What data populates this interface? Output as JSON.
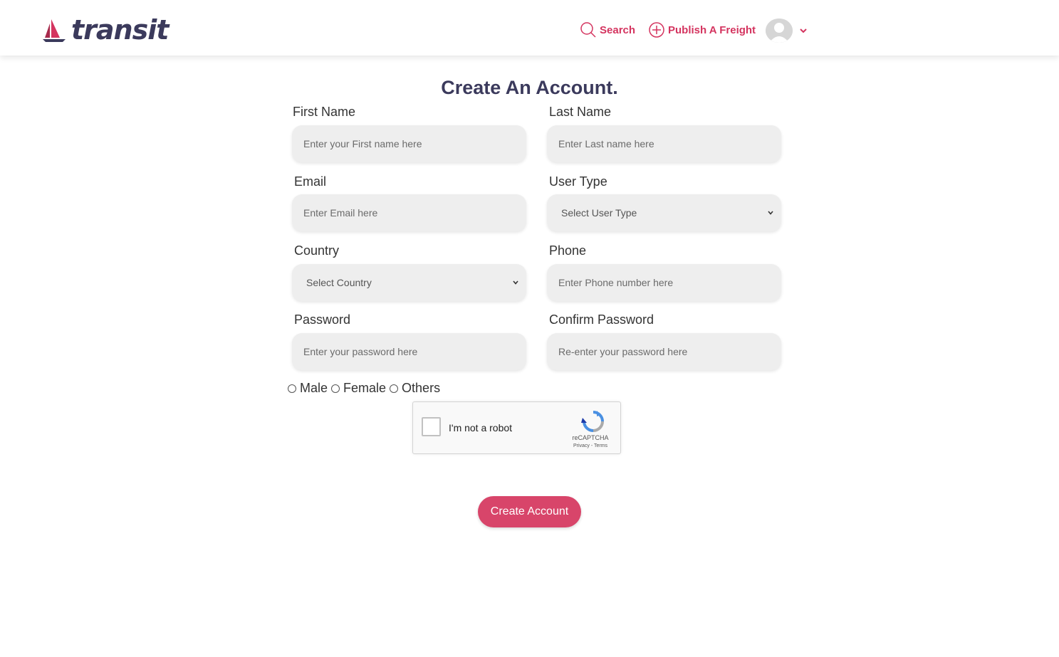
{
  "header": {
    "logo_text": "transit",
    "nav": {
      "search_label": "Search",
      "publish_label": "Publish A Freight"
    },
    "accent_color": "#d4345f",
    "brand_color": "#3b3a5c"
  },
  "form": {
    "title": "Create An Account.",
    "first_name": {
      "label": "First Name",
      "placeholder": "Enter your First name here",
      "value": ""
    },
    "last_name": {
      "label": "Last Name",
      "placeholder": "Enter Last name here",
      "value": ""
    },
    "email": {
      "label": "Email",
      "placeholder": "Enter Email here",
      "value": ""
    },
    "user_type": {
      "label": "User Type",
      "selected": "Select User Type"
    },
    "country": {
      "label": "Country",
      "selected": "Select Country"
    },
    "phone": {
      "label": "Phone",
      "placeholder": "Enter Phone number here",
      "value": ""
    },
    "password": {
      "label": "Password",
      "placeholder": "Enter your password here",
      "value": ""
    },
    "confirm_password": {
      "label": "Confirm Password",
      "placeholder": "Re-enter your password here",
      "value": ""
    },
    "gender_options": [
      "Male",
      "Female",
      "Others"
    ],
    "captcha": {
      "text": "I'm not a robot",
      "brand": "reCAPTCHA",
      "links": "Privacy - Terms"
    },
    "submit_label": "Create Account"
  }
}
